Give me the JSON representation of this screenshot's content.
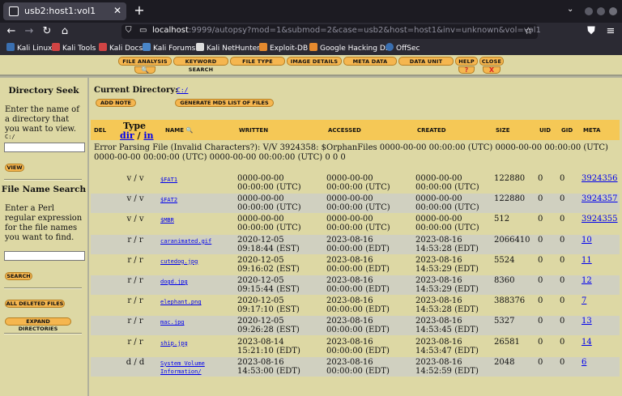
{
  "browser": {
    "tab_title": "usb2:host1:vol1",
    "url_host": "localhost",
    "url_rest": ":9999/autopsy?mod=1&submod=2&case=usb2&host=host1&inv=unknown&vol=vol1",
    "bookmarks": [
      "Kali Linux",
      "Kali Tools",
      "Kali Docs",
      "Kali Forums",
      "Kali NetHunter",
      "Exploit-DB",
      "Google Hacking DB",
      "OffSec"
    ]
  },
  "menu": {
    "file_analysis": "FILE ANALYSIS",
    "keyword_search": "KEYWORD SEARCH",
    "file_type": "FILE TYPE",
    "image_details": "IMAGE DETAILS",
    "meta_data": "META DATA",
    "data_unit": "DATA UNIT",
    "help": "HELP",
    "help_icon": "?",
    "close": "CLOSE",
    "close_icon": "X"
  },
  "left": {
    "dir_seek_title": "Directory Seek",
    "dir_seek_text": "Enter the name of a directory that you want to view.",
    "dir_path": "C:/",
    "view_btn": "VIEW",
    "name_search_title": "File Name Search",
    "name_search_text": "Enter a Perl regular expression for the file names you want to find.",
    "search_btn": "SEARCH",
    "all_deleted_btn": "ALL DELETED FILES",
    "expand_btn": "EXPAND DIRECTORIES"
  },
  "main": {
    "current_dir_label": "Current Directory:",
    "current_dir": "C:/",
    "add_note": "ADD NOTE",
    "md5_btn": "GENERATE MD5 LIST OF FILES",
    "headers": {
      "del": "DEL",
      "type": "Type",
      "type_dir": "dir",
      "type_sep": " / ",
      "type_in": "in",
      "name": "NAME",
      "written": "WRITTEN",
      "accessed": "ACCESSED",
      "created": "CREATED",
      "size": "SIZE",
      "uid": "UID",
      "gid": "GID",
      "meta": "META"
    },
    "error_text": "Error Parsing File (Invalid Characters?): V/V 3924358: $OrphanFiles 0000-00-00 00:00:00 (UTC) 0000-00-00 00:00:00 (UTC) 0000-00-00 00:00:00 (UTC) 0000-00-00 00:00:00 (UTC) 0 0 0",
    "rows": [
      {
        "type": "v / v",
        "name": "$FAT1",
        "w1": "0000-00-00",
        "w2": "00:00:00 (UTC)",
        "a1": "0000-00-00",
        "a2": "00:00:00 (UTC)",
        "c1": "0000-00-00",
        "c2": "00:00:00 (UTC)",
        "size": "122880",
        "uid": "0",
        "gid": "0",
        "meta": "3924356"
      },
      {
        "type": "v / v",
        "name": "$FAT2",
        "w1": "0000-00-00",
        "w2": "00:00:00 (UTC)",
        "a1": "0000-00-00",
        "a2": "00:00:00 (UTC)",
        "c1": "0000-00-00",
        "c2": "00:00:00 (UTC)",
        "size": "122880",
        "uid": "0",
        "gid": "0",
        "meta": "3924357"
      },
      {
        "type": "v / v",
        "name": "$MBR",
        "w1": "0000-00-00",
        "w2": "00:00:00 (UTC)",
        "a1": "0000-00-00",
        "a2": "00:00:00 (UTC)",
        "c1": "0000-00-00",
        "c2": "00:00:00 (UTC)",
        "size": "512",
        "uid": "0",
        "gid": "0",
        "meta": "3924355"
      },
      {
        "type": "r / r",
        "name": "caranimated.gif",
        "w1": "2020-12-05",
        "w2": "09:18:44 (EST)",
        "a1": "2023-08-16",
        "a2": "00:00:00 (EDT)",
        "c1": "2023-08-16",
        "c2": "14:53:28 (EDT)",
        "size": "2066410",
        "uid": "0",
        "gid": "0",
        "meta": "10"
      },
      {
        "type": "r / r",
        "name": "cutedog.jpg",
        "w1": "2020-12-05",
        "w2": "09:16:02 (EST)",
        "a1": "2023-08-16",
        "a2": "00:00:00 (EDT)",
        "c1": "2023-08-16",
        "c2": "14:53:29 (EDT)",
        "size": "5524",
        "uid": "0",
        "gid": "0",
        "meta": "11"
      },
      {
        "type": "r / r",
        "name": "dogd.jpg",
        "w1": "2020-12-05",
        "w2": "09:15:44 (EST)",
        "a1": "2023-08-16",
        "a2": "00:00:00 (EDT)",
        "c1": "2023-08-16",
        "c2": "14:53:29 (EDT)",
        "size": "8360",
        "uid": "0",
        "gid": "0",
        "meta": "12"
      },
      {
        "type": "r / r",
        "name": "elephant.png",
        "w1": "2020-12-05",
        "w2": "09:17:10 (EST)",
        "a1": "2023-08-16",
        "a2": "00:00:00 (EDT)",
        "c1": "2023-08-16",
        "c2": "14:53:28 (EDT)",
        "size": "388376",
        "uid": "0",
        "gid": "0",
        "meta": "7"
      },
      {
        "type": "r / r",
        "name": "mac.jpg",
        "w1": "2020-12-05",
        "w2": "09:26:28 (EST)",
        "a1": "2023-08-16",
        "a2": "00:00:00 (EDT)",
        "c1": "2023-08-16",
        "c2": "14:53:45 (EDT)",
        "size": "5327",
        "uid": "0",
        "gid": "0",
        "meta": "13"
      },
      {
        "type": "r / r",
        "name": "ship.jpg",
        "w1": "2023-08-14",
        "w2": "15:21:10 (EDT)",
        "a1": "2023-08-16",
        "a2": "00:00:00 (EDT)",
        "c1": "2023-08-16",
        "c2": "14:53:47 (EDT)",
        "size": "26581",
        "uid": "0",
        "gid": "0",
        "meta": "14"
      },
      {
        "type": "d / d",
        "name": "System Volume\nInformation/",
        "w1": "2023-08-16",
        "w2": "14:53:00 (EDT)",
        "a1": "2023-08-16",
        "a2": "00:00:00 (EDT)",
        "c1": "2023-08-16",
        "c2": "14:52:59 (EDT)",
        "size": "2048",
        "uid": "0",
        "gid": "0",
        "meta": "6"
      }
    ]
  }
}
